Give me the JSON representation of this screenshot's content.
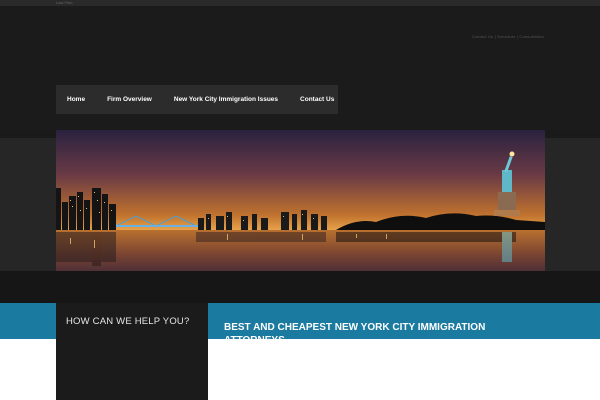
{
  "top_strip": {
    "tiny_text": "Law Firm"
  },
  "header": {
    "contact_text": "Contact Us  |  Schedule  |  Consultation"
  },
  "nav": {
    "items": [
      {
        "label": "Home"
      },
      {
        "label": "Firm Overview"
      },
      {
        "label": "New York City Immigration Issues"
      },
      {
        "label": "Contact Us"
      }
    ]
  },
  "banner": {
    "alt": "New York City skyline at night with Statue of Liberty"
  },
  "sidebar": {
    "heading": "HOW CAN WE HELP YOU?"
  },
  "main": {
    "title": "BEST AND CHEAPEST NEW YORK CITY IMMIGRATION ATTORNEYS"
  },
  "colors": {
    "accent_blue": "#1b7aa0",
    "background_dark": "#1b1b1b",
    "nav_bg": "#2c2c2c"
  }
}
